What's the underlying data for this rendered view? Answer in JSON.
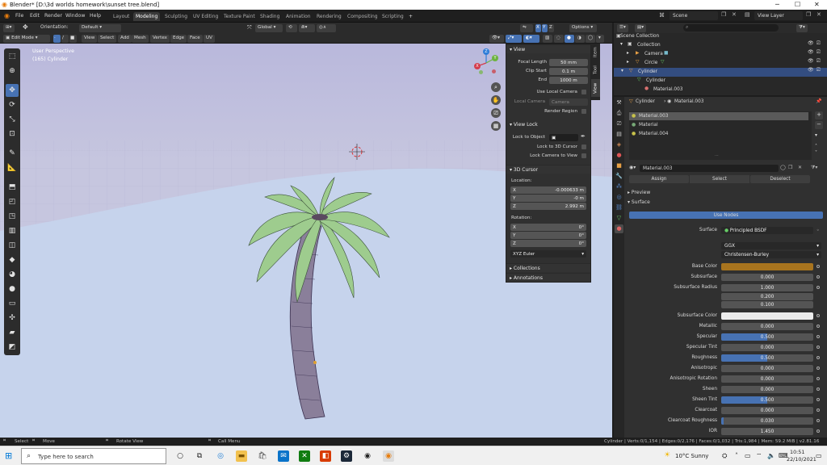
{
  "window": {
    "title": "Blender* [D:\\3d worlds homework\\sunset tree.blend]",
    "minimize": "─",
    "maximize": "☐",
    "close": "✕"
  },
  "menu": [
    "File",
    "Edit",
    "Render",
    "Window",
    "Help"
  ],
  "workspaces": [
    "Layout",
    "Modeling",
    "Sculpting",
    "UV Editing",
    "Texture Paint",
    "Shading",
    "Animation",
    "Rendering",
    "Compositing",
    "Scripting"
  ],
  "active_workspace": "Modeling",
  "scene": "Scene",
  "view_layer": "View Layer",
  "header": {
    "orientation_label": "Orientation:",
    "orientation_value": "Default",
    "transform_orientation": "Global",
    "options": "Options",
    "axis_x": "X",
    "axis_y": "Y",
    "axis_z": "Z"
  },
  "header2": {
    "mode": "Edit Mode",
    "menus": [
      "View",
      "Select",
      "Add",
      "Mesh",
      "Vertex",
      "Edge",
      "Face",
      "UV"
    ]
  },
  "viewport": {
    "overlay_line1": "User Perspective",
    "overlay_line2": "(165) Cylinder"
  },
  "npanel": {
    "view_title": "View",
    "focal_length_label": "Focal Length",
    "focal_length": "50 mm",
    "clip_start_label": "Clip Start",
    "clip_start": "0.1 m",
    "end_label": "End",
    "end": "1000 m",
    "use_local_camera": "Use Local Camera",
    "local_camera_label": "Local Camera",
    "local_camera_value": "Camera",
    "render_region": "Render Region",
    "view_lock_title": "View Lock",
    "lock_to_object": "Lock to Object",
    "lock_to_cursor": "Lock to 3D Cursor",
    "lock_camera": "Lock Camera to View",
    "cursor_title": "3D Cursor",
    "location_label": "Location:",
    "loc_x_label": "X",
    "loc_x": "-0.000633 m",
    "loc_y_label": "Y",
    "loc_y": "-0 m",
    "loc_z_label": "Z",
    "loc_z": "2.992 m",
    "rotation_label": "Rotation:",
    "rot_x_label": "X",
    "rot_x": "0°",
    "rot_y_label": "Y",
    "rot_y": "0°",
    "rot_z_label": "Z",
    "rot_z": "0°",
    "rot_mode": "XYZ Euler",
    "collections": "Collections",
    "annotations": "Annotations",
    "tabs": [
      "Item",
      "Tool",
      "View"
    ]
  },
  "gizmo": {
    "x": "X",
    "y": "Y",
    "z": "Z"
  },
  "outliner": {
    "search_placeholder": "",
    "rows": [
      "Scene Collection",
      "Collection",
      "Camera",
      "Circle",
      "Cylinder",
      "Cylinder",
      "Material.003"
    ]
  },
  "properties": {
    "breadcrumb_object": "Cylinder",
    "breadcrumb_material": "Material.003",
    "slots": [
      "Material.003",
      "Material",
      "Material.004"
    ],
    "material_name": "Material.003",
    "assign": "Assign",
    "select": "Select",
    "deselect": "Deselect",
    "preview": "Preview",
    "surface_section": "Surface",
    "use_nodes": "Use Nodes",
    "surface_label": "Surface",
    "surface_value": "Principled BSDF",
    "distribution": "GGX",
    "subsurface_method": "Christensen-Burley",
    "rows": [
      {
        "label": "Base Color",
        "value": "",
        "fill": 0,
        "color": "#a8741e"
      },
      {
        "label": "Subsurface",
        "value": "0.000",
        "fill": 0
      },
      {
        "label": "Subsurface Radius",
        "value": "1.000",
        "fill": 0
      },
      {
        "label": "",
        "value": "0.200",
        "fill": 0
      },
      {
        "label": "",
        "value": "0.100",
        "fill": 0
      },
      {
        "label": "Subsurface Color",
        "value": "",
        "fill": 0,
        "color": "#ebebeb"
      },
      {
        "label": "Metallic",
        "value": "0.000",
        "fill": 0
      },
      {
        "label": "Specular",
        "value": "0.500",
        "fill": 0.5
      },
      {
        "label": "Specular Tint",
        "value": "0.000",
        "fill": 0
      },
      {
        "label": "Roughness",
        "value": "0.500",
        "fill": 0.5
      },
      {
        "label": "Anisotropic",
        "value": "0.000",
        "fill": 0
      },
      {
        "label": "Anisotropic Rotation",
        "value": "0.000",
        "fill": 0
      },
      {
        "label": "Sheen",
        "value": "0.000",
        "fill": 0
      },
      {
        "label": "Sheen Tint",
        "value": "0.500",
        "fill": 0.5
      },
      {
        "label": "Clearcoat",
        "value": "0.000",
        "fill": 0
      },
      {
        "label": "Clearcoat Roughness",
        "value": "0.030",
        "fill": 0.03
      },
      {
        "label": "IOR",
        "value": "1.450",
        "fill": 0
      }
    ]
  },
  "statusbar": {
    "select": "Select",
    "move": "Move",
    "rotate_view": "Rotate View",
    "call_menu": "Call Menu",
    "stats": "Cylinder | Verts:0/1,154 | Edges:0/2,176 | Faces:0/1,032 | Tris:1,984 | Mem: 59.2 MiB | v2.81.16"
  },
  "taskbar": {
    "search_placeholder": "Type here to search",
    "weather": "10°C  Sunny",
    "time": "10:51",
    "date": "22/10/2021"
  }
}
